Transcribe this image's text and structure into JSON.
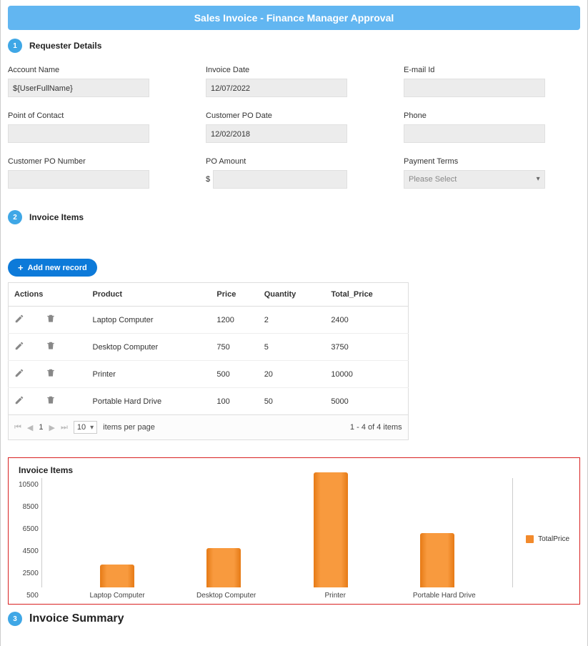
{
  "banner_title": "Sales Invoice - Finance Manager Approval",
  "steps": {
    "requester": {
      "num": "1",
      "title": "Requester Details"
    },
    "items": {
      "num": "2",
      "title": "Invoice Items"
    },
    "summary": {
      "num": "3",
      "title": "Invoice Summary"
    }
  },
  "form": {
    "account_name": {
      "label": "Account Name",
      "value": "${UserFullName}"
    },
    "invoice_date": {
      "label": "Invoice Date",
      "value": "12/07/2022"
    },
    "email": {
      "label": "E-mail Id",
      "value": ""
    },
    "poc": {
      "label": "Point of Contact",
      "value": ""
    },
    "cust_po_date": {
      "label": "Customer PO Date",
      "value": "12/02/2018"
    },
    "phone": {
      "label": "Phone",
      "value": ""
    },
    "cust_po_num": {
      "label": "Customer PO Number",
      "value": ""
    },
    "po_amount": {
      "label": "PO Amount",
      "currency": "$",
      "value": ""
    },
    "pay_terms": {
      "label": "Payment Terms",
      "placeholder": "Please Select"
    }
  },
  "add_button_label": "Add new record",
  "table": {
    "headers": {
      "actions": "Actions",
      "product": "Product",
      "price": "Price",
      "quantity": "Quantity",
      "total": "Total_Price"
    },
    "rows": [
      {
        "product": "Laptop Computer",
        "price": "1200",
        "quantity": "2",
        "total": "2400"
      },
      {
        "product": "Desktop Computer",
        "price": "750",
        "quantity": "5",
        "total": "3750"
      },
      {
        "product": "Printer",
        "price": "500",
        "quantity": "20",
        "total": "10000"
      },
      {
        "product": "Portable Hard Drive",
        "price": "100",
        "quantity": "50",
        "total": "5000"
      }
    ]
  },
  "pager": {
    "page": "1",
    "page_size": "10",
    "per_page_label": "items per page",
    "range": "1 - 4 of 4 items"
  },
  "chart_section_title": "Invoice Items",
  "chart_data": {
    "type": "bar",
    "categories": [
      "Laptop Computer",
      "Desktop Computer",
      "Printer",
      "Portable Hard Drive"
    ],
    "values": [
      2400,
      3750,
      10000,
      5000
    ],
    "y_ticks": [
      10500,
      8500,
      6500,
      4500,
      2500,
      500
    ],
    "ylim": [
      500,
      10500
    ],
    "legend": "TotalPrice"
  }
}
